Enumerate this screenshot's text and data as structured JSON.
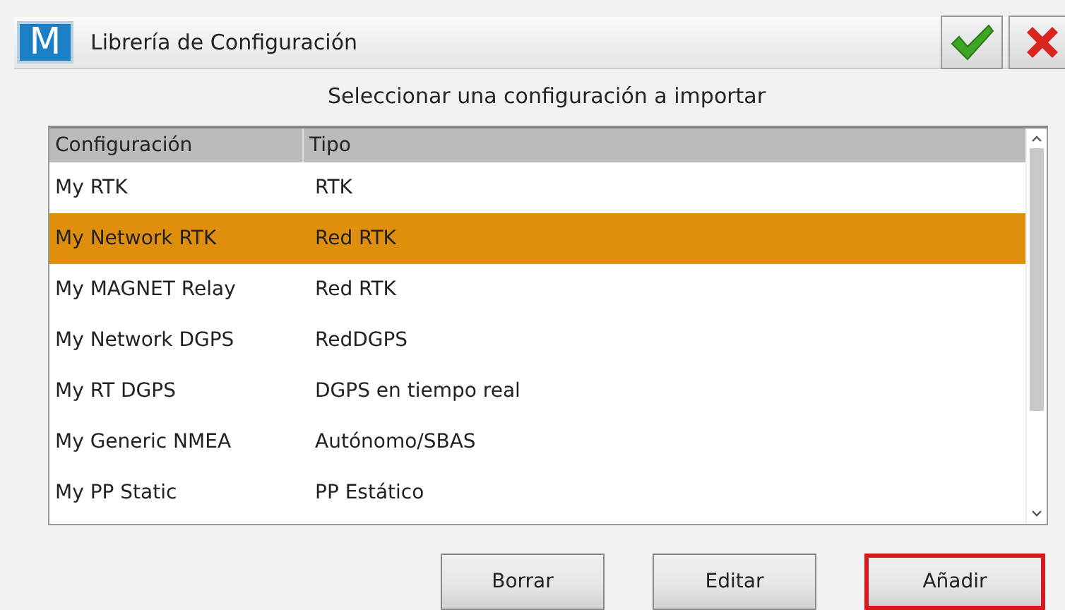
{
  "window": {
    "logo": "M",
    "title": "Librería de Configuración"
  },
  "prompt": "Seleccionar una configuración a importar",
  "table": {
    "columns": [
      "Configuración",
      "Tipo"
    ],
    "rows": [
      {
        "name": "My RTK",
        "type": "RTK",
        "selected": false
      },
      {
        "name": "My Network RTK",
        "type": "Red RTK",
        "selected": true
      },
      {
        "name": "My MAGNET Relay",
        "type": "Red RTK",
        "selected": false
      },
      {
        "name": "My Network DGPS",
        "type": "RedDGPS",
        "selected": false
      },
      {
        "name": "My RT DGPS",
        "type": "DGPS en tiempo real",
        "selected": false
      },
      {
        "name": "My Generic NMEA",
        "type": "Autónomo/SBAS",
        "selected": false
      },
      {
        "name": "My PP Static",
        "type": "PP Estático",
        "selected": false
      }
    ]
  },
  "buttons": [
    {
      "label": "Borrar",
      "focused": false
    },
    {
      "label": "Editar",
      "focused": false
    },
    {
      "label": "Añadir",
      "focused": true
    }
  ]
}
